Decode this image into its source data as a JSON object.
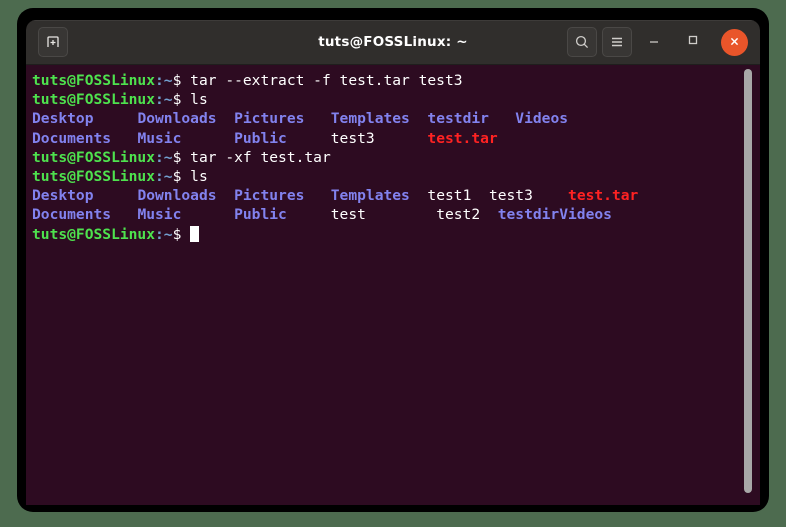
{
  "window": {
    "title": "tuts@FOSSLinux: ~",
    "titlebar_bg": "#302e2c",
    "terminal_bg": "#2d0b21",
    "desktop_bg": "#4d6b4f",
    "close_btn_color": "#e9552a"
  },
  "titlebar": {
    "new_tab_icon": "new-tab-icon",
    "search_icon": "search-icon",
    "menu_icon": "hamburger-menu-icon",
    "minimize_icon": "minimize-icon",
    "maximize_icon": "maximize-icon",
    "close_icon": "close-icon"
  },
  "terminal": {
    "prompt_user": "tuts@FOSSLinux",
    "prompt_path": ":~",
    "prompt_symbol": "$ ",
    "colors": {
      "prompt_green": "#4ee24e",
      "path_blue": "#729fcf",
      "directory_blue": "#8282ee",
      "file_white": "#ffffff",
      "archive_red": "#ff2222"
    },
    "lines": [
      {
        "type": "command",
        "command": "tar --extract -f test.tar test3"
      },
      {
        "type": "command",
        "command": "ls"
      },
      {
        "type": "output",
        "cells": [
          {
            "text": "Desktop",
            "kind": "dir",
            "pad": 12
          },
          {
            "text": "Downloads",
            "kind": "dir",
            "pad": 11
          },
          {
            "text": "Pictures",
            "kind": "dir",
            "pad": 11
          },
          {
            "text": "Templates",
            "kind": "dir",
            "pad": 11
          },
          {
            "text": "testdir",
            "kind": "dir",
            "pad": 10
          },
          {
            "text": "Videos",
            "kind": "dir",
            "pad": 0
          }
        ]
      },
      {
        "type": "output",
        "cells": [
          {
            "text": "Documents",
            "kind": "dir",
            "pad": 12
          },
          {
            "text": "Music",
            "kind": "dir",
            "pad": 11
          },
          {
            "text": "Public",
            "kind": "dir",
            "pad": 11
          },
          {
            "text": "test3",
            "kind": "file",
            "pad": 11
          },
          {
            "text": "test.tar",
            "kind": "archive",
            "pad": 0
          }
        ]
      },
      {
        "type": "command",
        "command": "tar -xf test.tar"
      },
      {
        "type": "command",
        "command": "ls"
      },
      {
        "type": "output",
        "cells": [
          {
            "text": "Desktop",
            "kind": "dir",
            "pad": 12
          },
          {
            "text": "Downloads",
            "kind": "dir",
            "pad": 11
          },
          {
            "text": "Pictures",
            "kind": "dir",
            "pad": 11
          },
          {
            "text": "Templates",
            "kind": "dir",
            "pad": 11
          },
          {
            "text": "test1",
            "kind": "file",
            "pad": 7
          },
          {
            "text": "test3",
            "kind": "file",
            "pad": 9
          },
          {
            "text": "test.tar",
            "kind": "archive",
            "pad": 0
          }
        ]
      },
      {
        "type": "output",
        "cells": [
          {
            "text": "Documents",
            "kind": "dir",
            "pad": 12
          },
          {
            "text": "Music",
            "kind": "dir",
            "pad": 11
          },
          {
            "text": "Public",
            "kind": "dir",
            "pad": 11
          },
          {
            "text": "test",
            "kind": "file",
            "pad": 12
          },
          {
            "text": "test2",
            "kind": "file",
            "pad": 7
          },
          {
            "text": "testdir",
            "kind": "dir",
            "pad": 7
          },
          {
            "text": "Videos",
            "kind": "dir",
            "pad": 0
          }
        ]
      },
      {
        "type": "prompt_only",
        "command": ""
      }
    ]
  },
  "scrollbar": {
    "thumb_color": "#a8a8a8"
  }
}
